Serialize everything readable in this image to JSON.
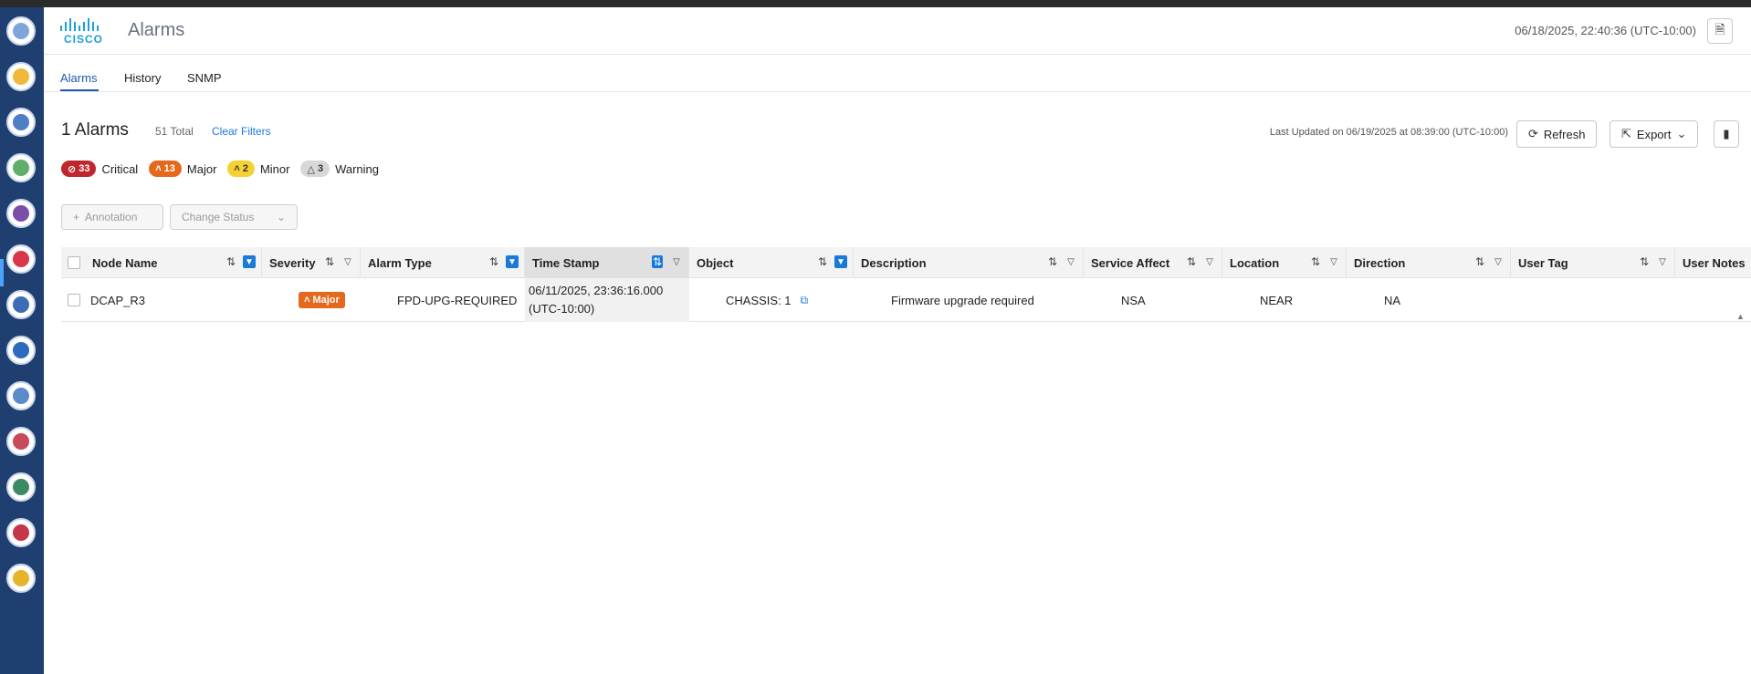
{
  "header": {
    "logo_text": "CISCO",
    "app_title": "Alarms",
    "datetime": "06/18/2025, 22:40:36 (UTC-10:00)",
    "doc_icon": "document-icon"
  },
  "tabs": [
    {
      "label": "Alarms",
      "active": true
    },
    {
      "label": "History",
      "active": false
    },
    {
      "label": "SNMP",
      "active": false
    }
  ],
  "summary": {
    "count_title": "1 Alarms",
    "total": "51 Total",
    "clear_filters": "Clear Filters",
    "last_updated": "Last Updated on 06/19/2025 at 08:39:00 (UTC-10:00)",
    "refresh_label": "Refresh",
    "export_label": "Export"
  },
  "severity_counts": [
    {
      "count": "33",
      "label": "Critical",
      "color": "#c0272d"
    },
    {
      "count": "13",
      "label": "Major",
      "color": "#e5691d"
    },
    {
      "count": "2",
      "label": "Minor",
      "color": "#f5d132"
    },
    {
      "count": "3",
      "label": "Warning",
      "color": "#d8d8d8"
    }
  ],
  "actions": {
    "annotation_label": "Annotation",
    "change_status_label": "Change Status"
  },
  "table": {
    "columns": [
      "Node Name",
      "Severity",
      "Alarm Type",
      "Time Stamp",
      "Object",
      "Description",
      "Service Affect",
      "Location",
      "Direction",
      "User Tag",
      "User Notes"
    ],
    "rows": [
      {
        "node_name": "DCAP_R3",
        "severity": "Major",
        "alarm_type": "FPD-UPG-REQUIRED",
        "timestamp_line1": "06/11/2025, 23:36:16.000",
        "timestamp_line2": "(UTC-10:00)",
        "object": "CHASSIS: 1",
        "description": "Firmware upgrade required",
        "service_affect": "NSA",
        "location": "NEAR",
        "direction": "NA",
        "user_tag": "",
        "user_notes": ""
      }
    ]
  },
  "colors": {
    "rail": "#1f3f70",
    "accent": "#1b7ad9",
    "major": "#e5691d",
    "critical": "#c0272d"
  }
}
